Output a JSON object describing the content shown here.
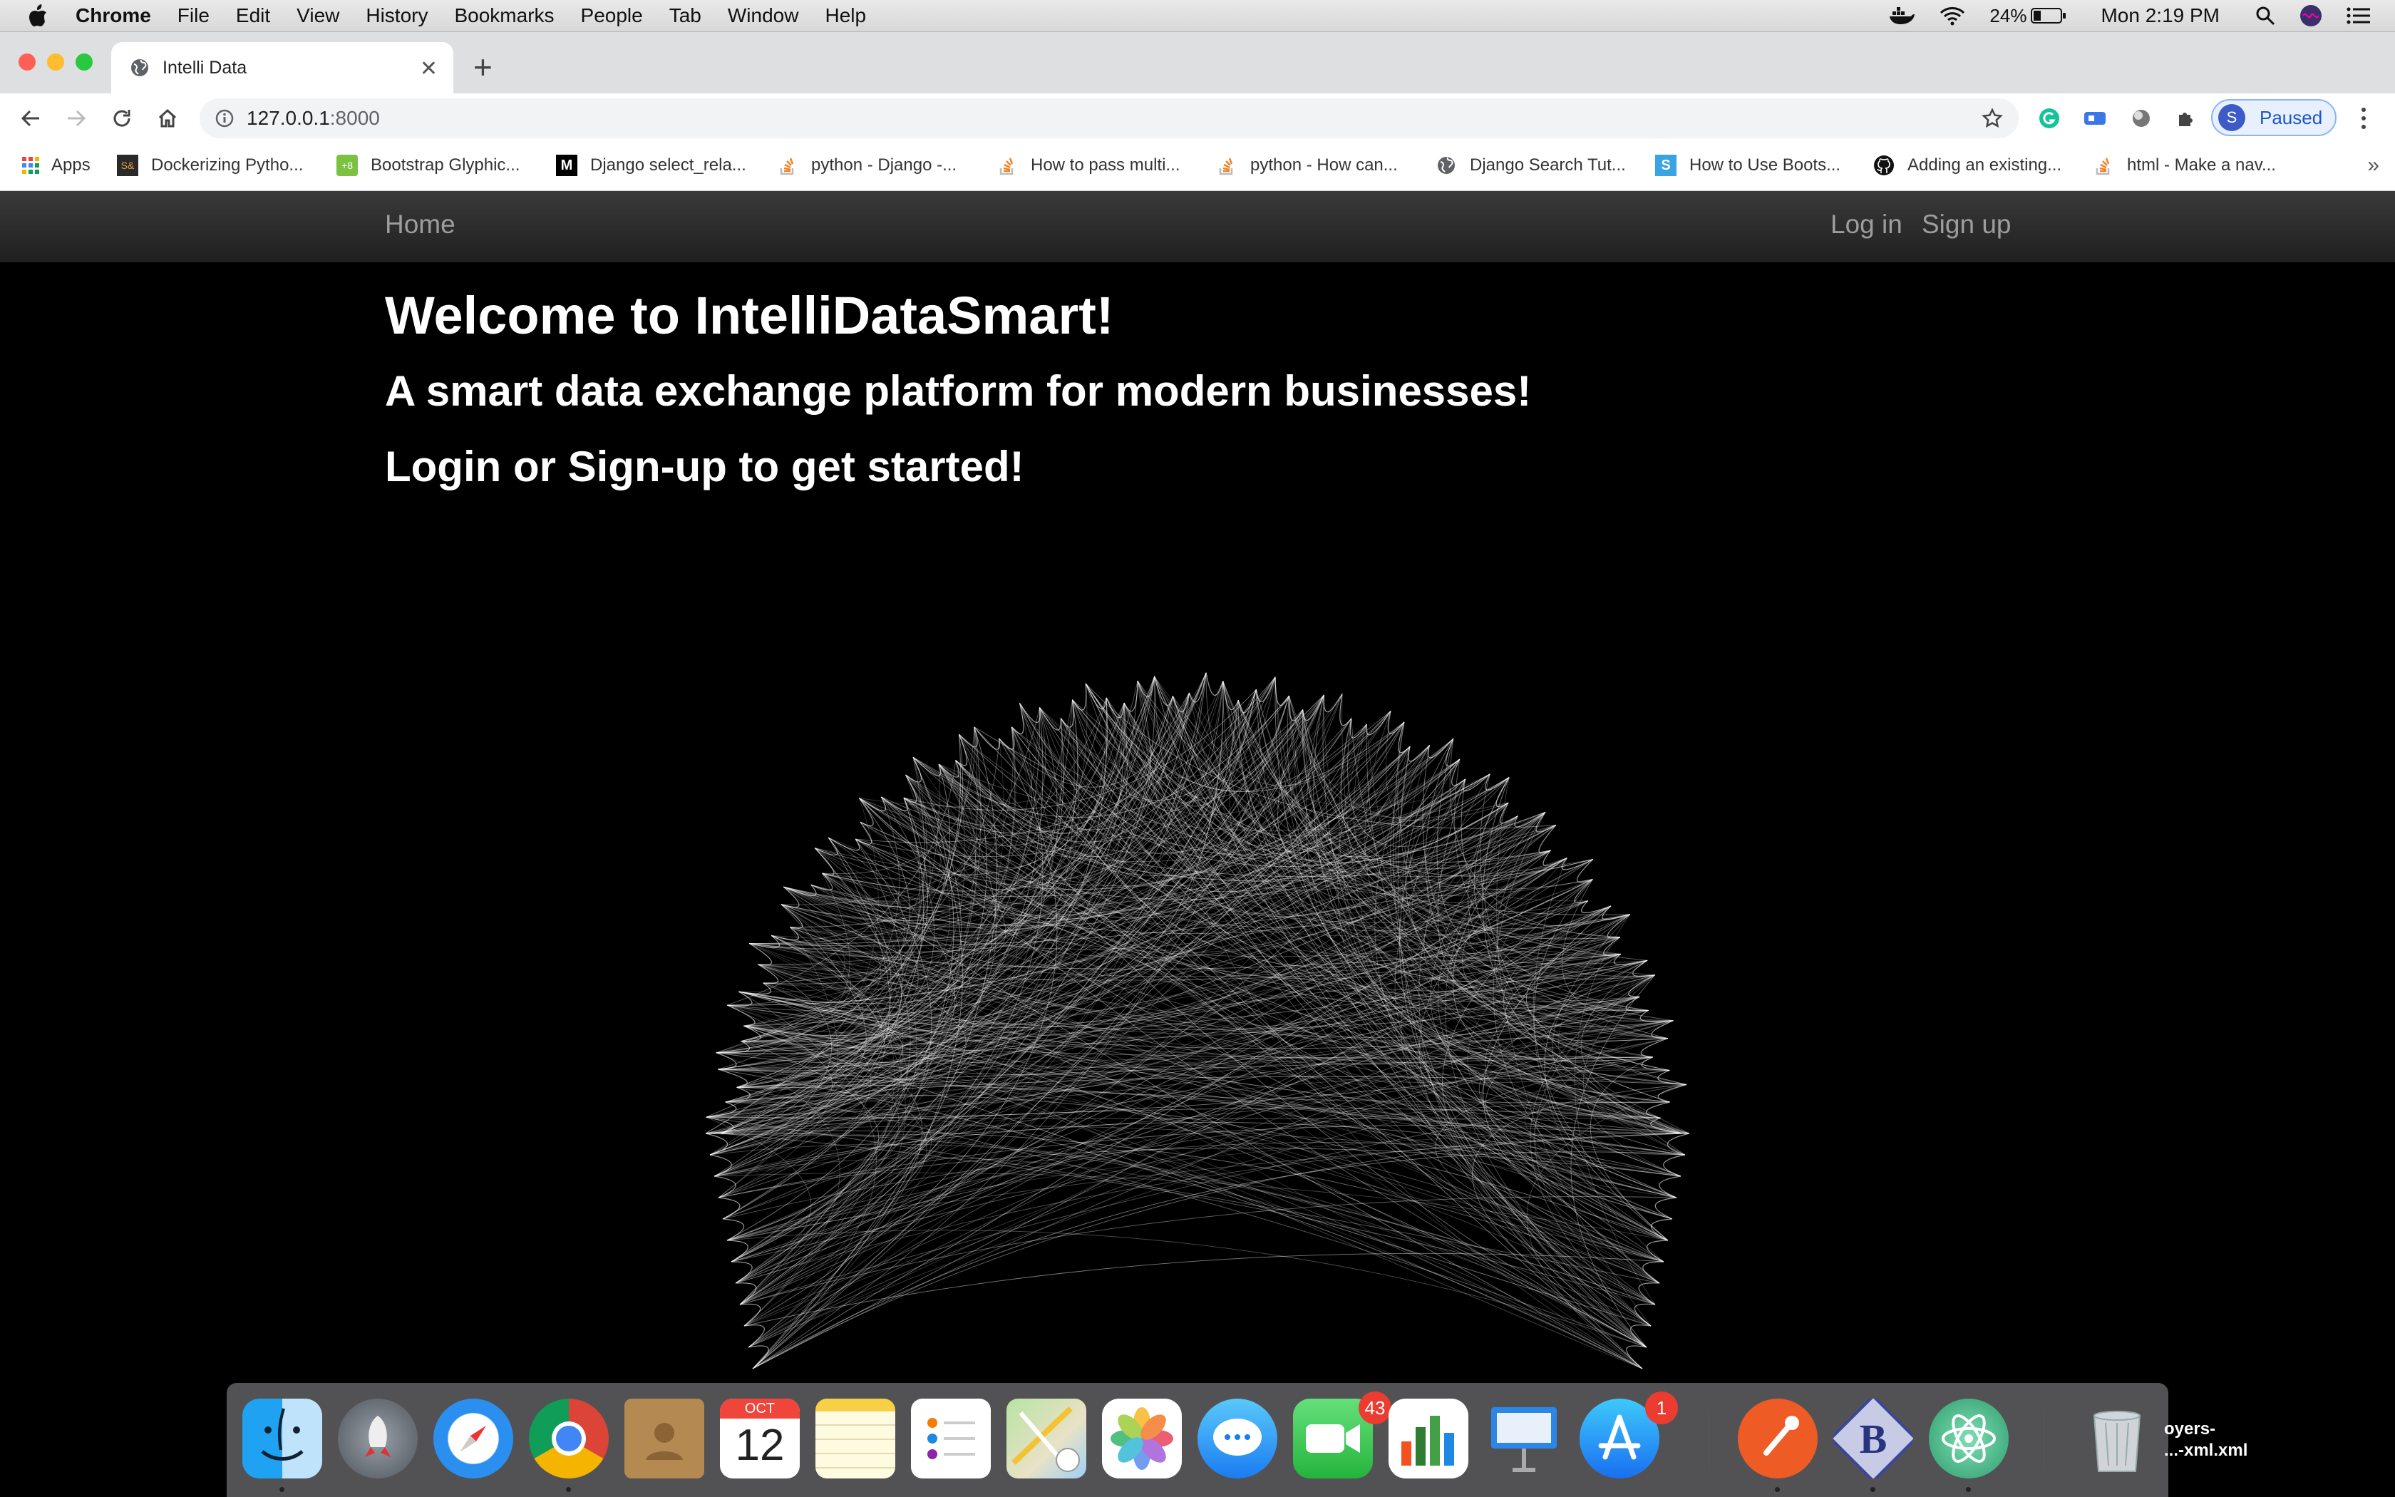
{
  "menubar": {
    "app": "Chrome",
    "items": [
      "File",
      "Edit",
      "View",
      "History",
      "Bookmarks",
      "People",
      "Tab",
      "Window",
      "Help"
    ],
    "battery": "24%",
    "clock": "Mon 2:19 PM"
  },
  "browser": {
    "tab_title": "Intelli Data",
    "url_host": "127.0.0.1",
    "url_port": ":8000",
    "profile_initial": "S",
    "profile_status": "Paused"
  },
  "bookmarks": [
    {
      "label": "Apps",
      "icon": "apps-grid-icon"
    },
    {
      "label": "Dockerizing Pytho...",
      "icon": "testdriven-icon"
    },
    {
      "label": "Bootstrap Glyphic...",
      "icon": "bootstrap-icon"
    },
    {
      "label": "Django select_rela...",
      "icon": "medium-icon"
    },
    {
      "label": "python - Django -...",
      "icon": "stackoverflow-icon"
    },
    {
      "label": "How to pass multi...",
      "icon": "stackoverflow-icon"
    },
    {
      "label": "python - How can...",
      "icon": "stackoverflow-icon"
    },
    {
      "label": "Django Search Tut...",
      "icon": "globe-icon"
    },
    {
      "label": "How to Use Boots...",
      "icon": "s-icon"
    },
    {
      "label": "Adding an existing...",
      "icon": "github-icon"
    },
    {
      "label": "html - Make a nav...",
      "icon": "stackoverflow-icon"
    }
  ],
  "site": {
    "nav_home": "Home",
    "nav_login": "Log in",
    "nav_signup": "Sign up",
    "heading": "Welcome to IntelliDataSmart!",
    "subheading": "A smart data exchange platform for modern businesses!",
    "cta": "Login or Sign-up to get started!"
  },
  "dock": {
    "calendar_month": "OCT",
    "calendar_day": "12",
    "facetime_badge": "43",
    "appstore_badge": "1",
    "file_label_1": "oyers-",
    "file_label_2": "...-xml.xml"
  },
  "colors": {
    "page_bg": "#000000",
    "nav_bg": "#222222",
    "nav_link": "#9d9d9d",
    "hero_text": "#ffffff"
  }
}
